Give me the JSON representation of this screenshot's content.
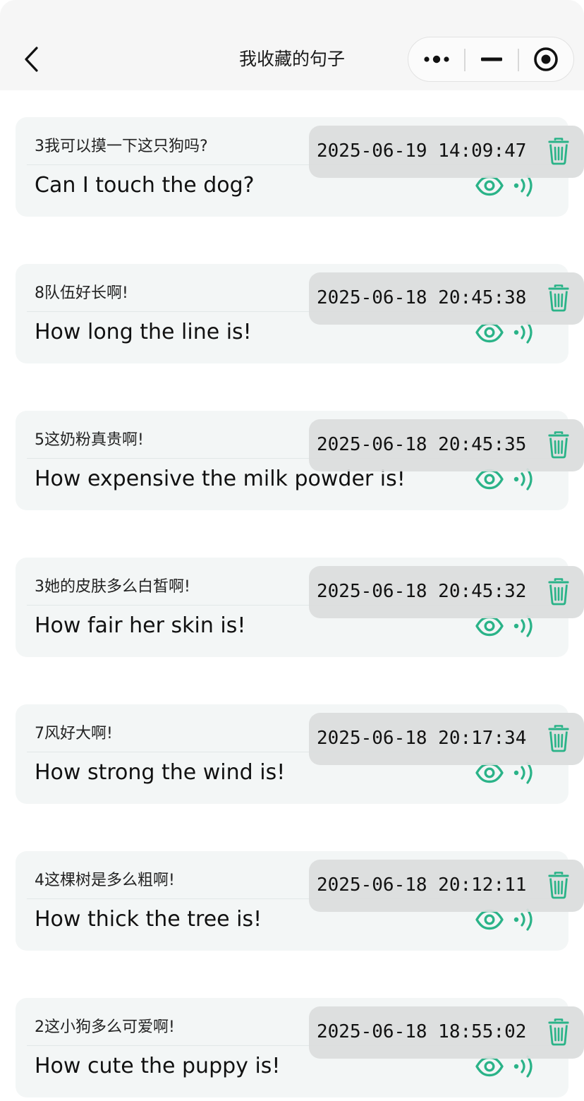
{
  "header": {
    "title": "我收藏的句子",
    "back_icon": "chevron-left-icon",
    "capsule_icons": [
      "more-dots-icon",
      "minimize-icon",
      "target-close-icon"
    ]
  },
  "accent_color": "#2ab388",
  "sentences": [
    {
      "timestamp": "2025-06-19 14:09:47",
      "chinese": "3我可以摸一下这只狗吗?",
      "english": "Can I touch the dog?"
    },
    {
      "timestamp": "2025-06-18 20:45:38",
      "chinese": "8队伍好长啊!",
      "english": "How long the line is!"
    },
    {
      "timestamp": "2025-06-18 20:45:35",
      "chinese": "5这奶粉真贵啊!",
      "english": "How expensive the milk powder is!"
    },
    {
      "timestamp": "2025-06-18 20:45:32",
      "chinese": "3她的皮肤多么白皙啊!",
      "english": "How fair her skin is!"
    },
    {
      "timestamp": "2025-06-18 20:17:34",
      "chinese": "7风好大啊!",
      "english": "How strong the wind is!"
    },
    {
      "timestamp": "2025-06-18 20:12:11",
      "chinese": "4这棵树是多么粗啊!",
      "english": "How thick the tree is!"
    },
    {
      "timestamp": "2025-06-18 18:55:02",
      "chinese": "2这小狗多么可爱啊!",
      "english": "How cute the puppy is!"
    }
  ]
}
